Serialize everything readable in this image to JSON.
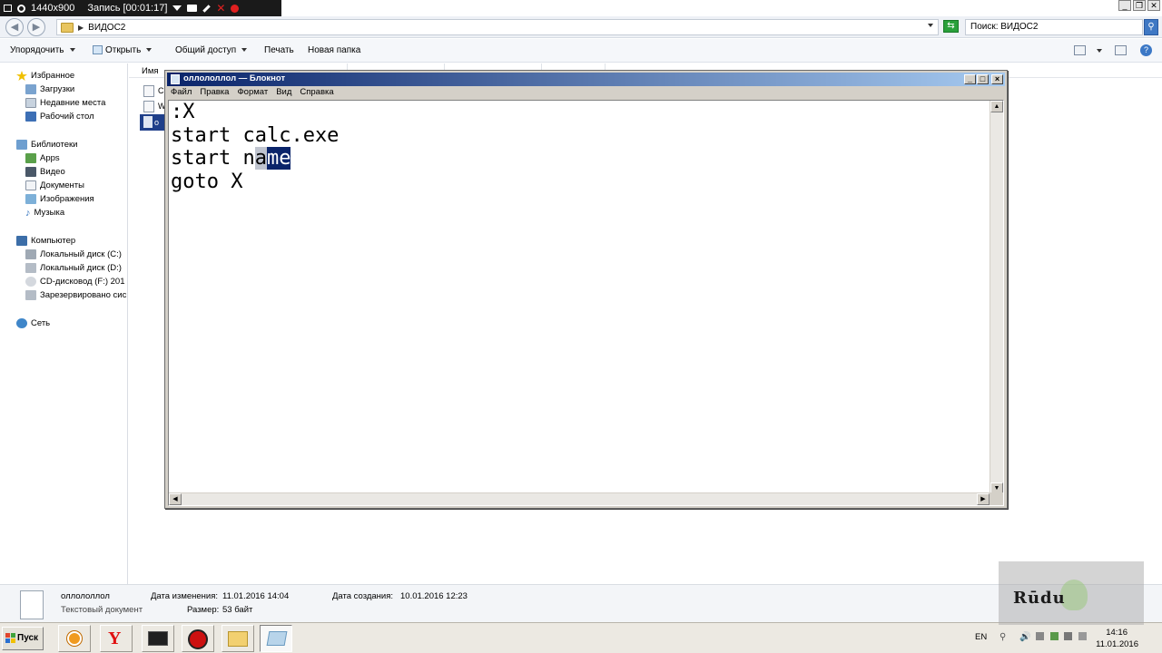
{
  "recorder": {
    "resolution": "1440x900",
    "recording": "Запись [00:01:17]"
  },
  "explorer": {
    "address_path": "ВИДОС2",
    "search_placeholder": "Поиск: ВИДОС2",
    "toolbar": {
      "organize": "Упорядочить",
      "open": "Открыть",
      "share": "Общий доступ",
      "print": "Печать",
      "new_folder": "Новая папка"
    },
    "column_name": "Имя",
    "files": [
      {
        "tag": "С"
      },
      {
        "tag": "W"
      },
      {
        "tag": "о"
      }
    ],
    "sidebar": {
      "favorites": "Избранное",
      "downloads": "Загрузки",
      "recent": "Недавние места",
      "desktop": "Рабочий стол",
      "libraries": "Библиотеки",
      "apps": "Apps",
      "video": "Видео",
      "documents": "Документы",
      "images": "Изображения",
      "music": "Музыка",
      "computer": "Компьютер",
      "disk_c": "Локальный диск (C:)",
      "disk_d": "Локальный диск (D:)",
      "cd": "CD-дисковод (F:) 201",
      "reserved": "Зарезервировано сис",
      "network": "Сеть"
    },
    "details": {
      "filename": "оллололлол",
      "filetype": "Текстовый документ",
      "modified_label": "Дата изменения:",
      "modified_value": "11.01.2016 14:04",
      "size_label": "Размер:",
      "size_value": "53 байт",
      "created_label": "Дата создания:",
      "created_value": "10.01.2016 12:23"
    }
  },
  "notepad": {
    "title": "оллололлол — Блокнот",
    "menu": [
      "Файл",
      "Правка",
      "Формат",
      "Вид",
      "Справка"
    ],
    "lines": [
      ":X",
      "start calc.exe",
      "goto X"
    ],
    "line3_plain": "start n",
    "line3_caret": "a",
    "line3_selected": "me"
  },
  "watermark": "Rūdu",
  "taskbar": {
    "start_label": "Пуск",
    "lang": "EN",
    "time": "14:16",
    "date": "11.01.2016"
  }
}
